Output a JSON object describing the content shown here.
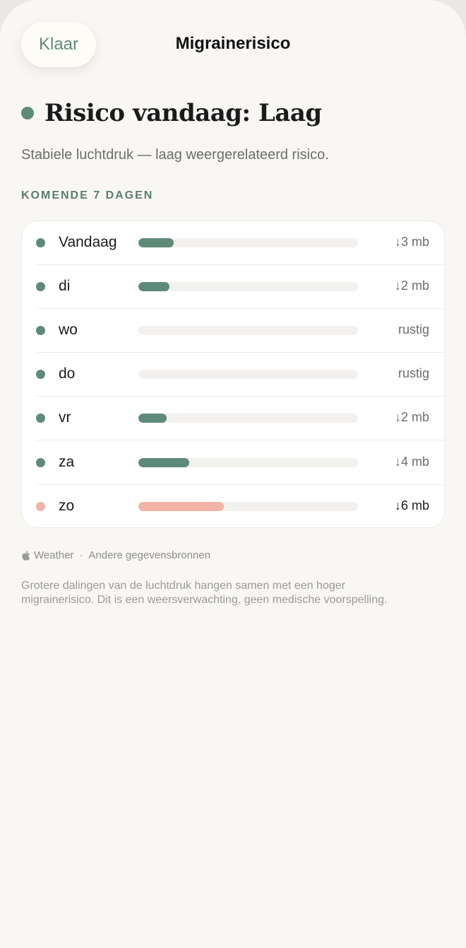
{
  "header": {
    "done_label": "Klaar",
    "title": "Migrainerisico"
  },
  "risk": {
    "title": "Risico vandaag: Laag",
    "level_color": "#5e8a7a",
    "subtitle": "Stabiele luchtdruk — laag weergerelateerd risico."
  },
  "forecast": {
    "section_label": "KOMENDE 7 DAGEN",
    "days": [
      {
        "day": "Vandaag",
        "value": "↓3 mb",
        "level": 0.16,
        "color": "#5e8a7a",
        "alert": false
      },
      {
        "day": "di",
        "value": "↓2 mb",
        "level": 0.14,
        "color": "#5e8a7a",
        "alert": false
      },
      {
        "day": "wo",
        "value": "rustig",
        "level": 0,
        "color": "#5e8a7a",
        "alert": false
      },
      {
        "day": "do",
        "value": "rustig",
        "level": 0,
        "color": "#5e8a7a",
        "alert": false
      },
      {
        "day": "vr",
        "value": "↓2 mb",
        "level": 0.13,
        "color": "#5e8a7a",
        "alert": false
      },
      {
        "day": "za",
        "value": "↓4 mb",
        "level": 0.23,
        "color": "#5e8a7a",
        "alert": false
      },
      {
        "day": "zo",
        "value": "↓6 mb",
        "level": 0.39,
        "color": "#f2b3a6",
        "alert": true
      }
    ]
  },
  "source": {
    "icon": "apple-icon",
    "weather_label": "Weather",
    "separator": "·",
    "other_sources_label": "Andere gegevensbronnen"
  },
  "footnote": "Grotere dalingen van de luchtdruk hangen samen met een hoger migrainerisico. Dit is een weersverwachting, geen medische voorspelling."
}
